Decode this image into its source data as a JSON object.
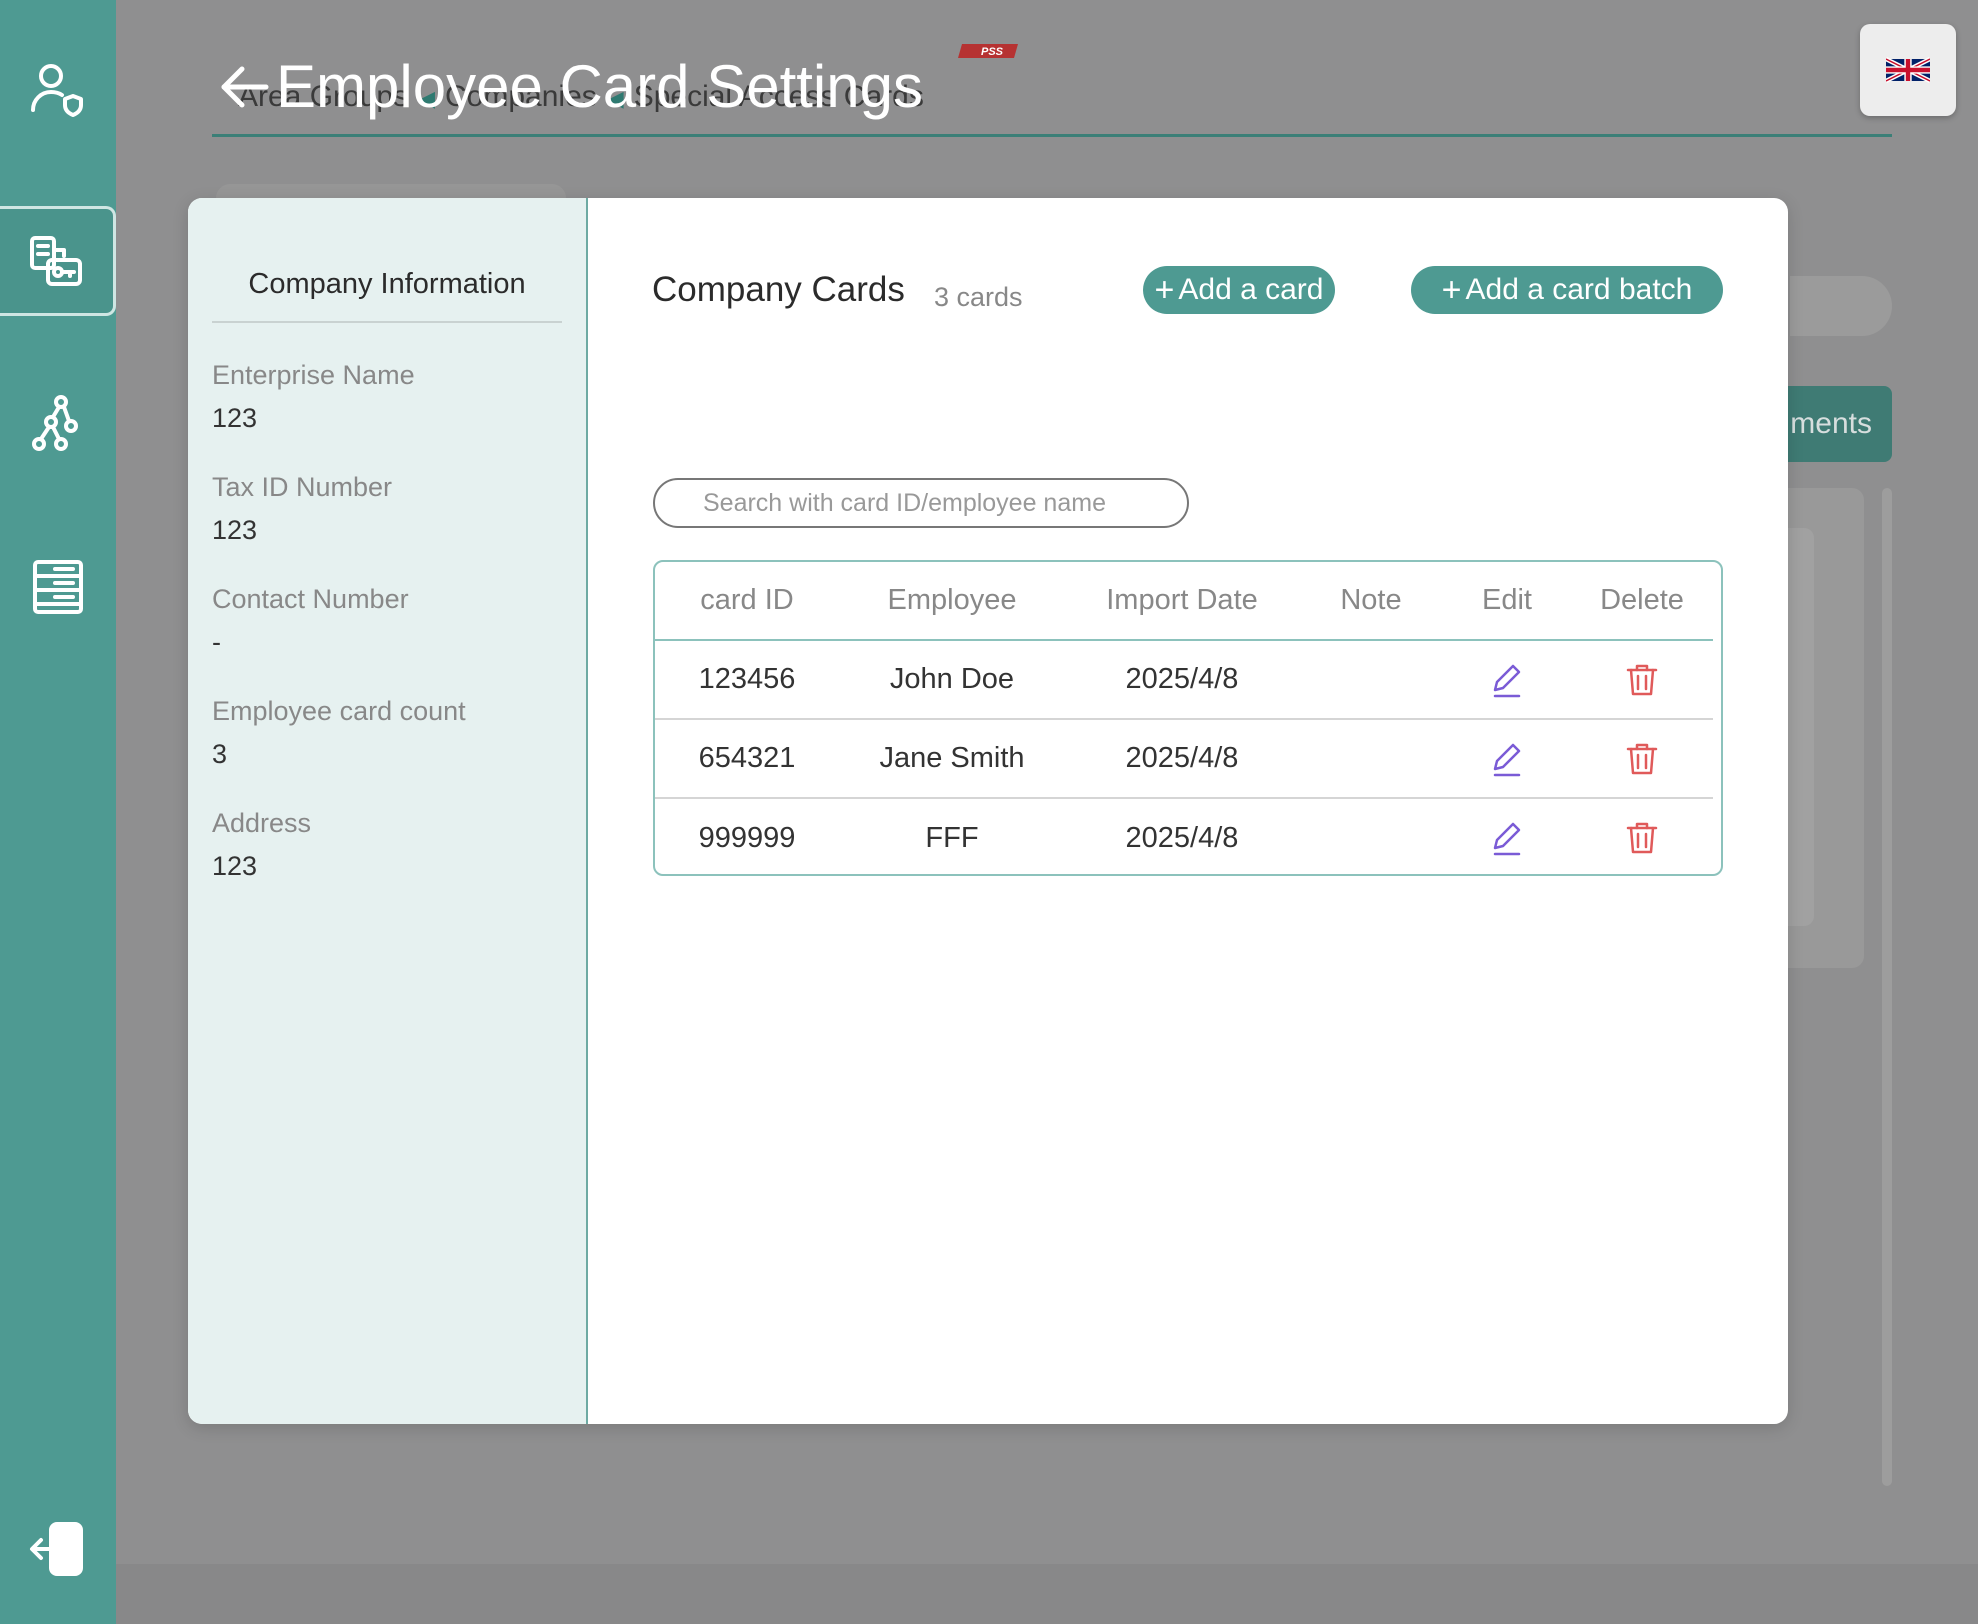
{
  "sidebar": {
    "items": [
      {
        "name": "user-shield",
        "icon": "user-shield-icon"
      },
      {
        "name": "card-key",
        "icon": "card-key-icon",
        "active": true
      },
      {
        "name": "hierarchy",
        "icon": "hierarchy-icon"
      },
      {
        "name": "list-panel",
        "icon": "list-panel-icon"
      }
    ],
    "logout_icon": "logout-icon"
  },
  "header": {
    "title": "Employee Card Settings",
    "back_icon": "arrow-left-icon",
    "logo_text": "PSS",
    "language_icon": "uk-flag-icon"
  },
  "background": {
    "breadcrumb": [
      "Area Groups",
      "Companies",
      "Special Access Cards"
    ],
    "tab_fragment": "ments"
  },
  "modal": {
    "info": {
      "title": "Company Information",
      "fields": [
        {
          "label": "Enterprise Name",
          "value": "123"
        },
        {
          "label": "Tax ID Number",
          "value": "123"
        },
        {
          "label": "Contact Number",
          "value": "-"
        },
        {
          "label": "Employee card count",
          "value": "3"
        },
        {
          "label": "Address",
          "value": "123"
        }
      ]
    },
    "cards": {
      "title": "Company Cards",
      "count": "3 cards",
      "add_card": "Add a card",
      "add_batch": "Add a card batch",
      "search_placeholder": "Search with card ID/employee name",
      "columns": [
        "card ID",
        "Employee",
        "Import Date",
        "Note",
        "Edit",
        "Delete"
      ],
      "rows": [
        {
          "card_id": "123456",
          "employee": "John Doe",
          "import_date": "2025/4/8",
          "note": ""
        },
        {
          "card_id": "654321",
          "employee": "Jane Smith",
          "import_date": "2025/4/8",
          "note": ""
        },
        {
          "card_id": "999999",
          "employee": "FFF",
          "import_date": "2025/4/8",
          "note": ""
        }
      ]
    }
  },
  "colors": {
    "accent": "#4e9a92",
    "edit": "#7a5bd6",
    "delete": "#e05a5a",
    "overlay": "#8f8f90"
  }
}
